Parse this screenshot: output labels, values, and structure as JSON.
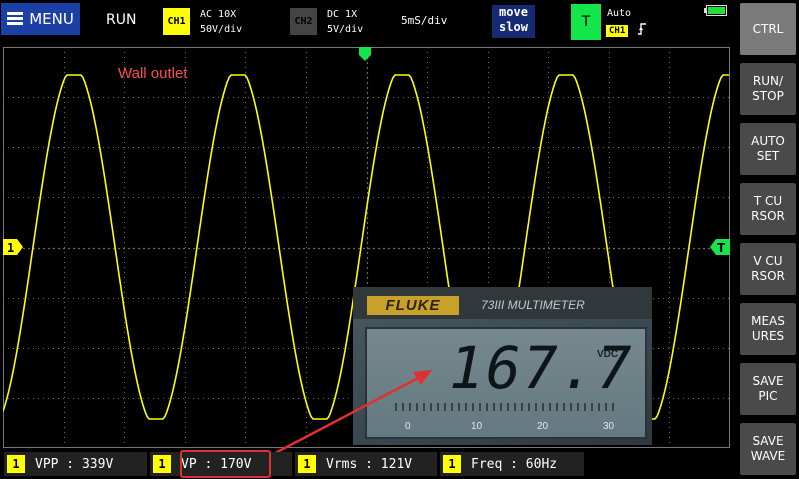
{
  "header": {
    "menu_label": "MENU",
    "run_state": "RUN",
    "ch1": {
      "label": "CH1",
      "coupling": "AC  10X",
      "scale": "50V/div"
    },
    "ch2": {
      "label": "CH2",
      "coupling": "DC  1X",
      "scale": "5V/div"
    },
    "timebase": "5mS/div",
    "move": {
      "line1": "move",
      "line2": "slow"
    },
    "trigger": {
      "label": "T",
      "mode": "Auto",
      "source": "CH1",
      "edge": "rising-edge-icon"
    },
    "battery_level": 1.0
  },
  "screen": {
    "annotation": "Wall outlet",
    "ch1_marker": "1",
    "trigger_marker": "T",
    "colors": {
      "trace": "#ffff00",
      "grid": "#6a6a6a",
      "annotation": "#ff4c4c",
      "trigger": "#12e64a"
    }
  },
  "meter": {
    "brand": "FLUKE",
    "model": "73III MULTIMETER",
    "reading": "167.7",
    "unit": "VDC",
    "scale": [
      "0",
      "10",
      "20",
      "30"
    ]
  },
  "measurements": [
    {
      "channel": "1",
      "label": "VPP  : 339V"
    },
    {
      "channel": "1",
      "label": "VP  : 170V"
    },
    {
      "channel": "1",
      "label": "Vrms : 121V"
    },
    {
      "channel": "1",
      "label": "Freq : 60Hz"
    }
  ],
  "sidebar": [
    {
      "label": "CTRL"
    },
    {
      "label": "RUN/\nSTOP"
    },
    {
      "label": "AUTO\nSET"
    },
    {
      "label": "T  CU\nRSOR"
    },
    {
      "label": "V  CU\nRSOR"
    },
    {
      "label": "MEAS\nURES"
    },
    {
      "label": "SAVE\nPIC"
    },
    {
      "label": "SAVE\nWAVE"
    }
  ]
}
